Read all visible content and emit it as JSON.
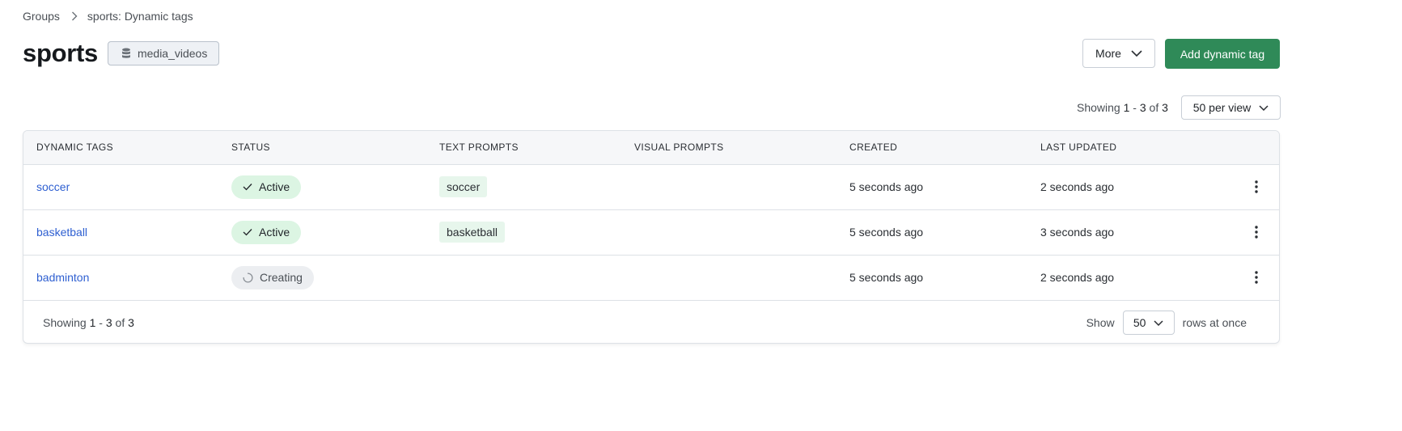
{
  "breadcrumb": {
    "parent": "Groups",
    "current": "sports: Dynamic tags"
  },
  "header": {
    "title": "sports",
    "index_badge": "media_videos",
    "more_label": "More",
    "add_label": "Add dynamic tag"
  },
  "pager_top": {
    "prefix": "Showing",
    "range_start": "1",
    "dash": "-",
    "range_end": "3",
    "of": "of",
    "total": "3",
    "per_view": "50 per view"
  },
  "table": {
    "columns": [
      "DYNAMIC TAGS",
      "STATUS",
      "TEXT PROMPTS",
      "VISUAL PROMPTS",
      "CREATED",
      "LAST UPDATED"
    ],
    "rows": [
      {
        "name": "soccer",
        "status": "Active",
        "status_kind": "active",
        "text_prompt": "soccer",
        "visual_prompt": "",
        "created": "5 seconds ago",
        "updated": "2 seconds ago"
      },
      {
        "name": "basketball",
        "status": "Active",
        "status_kind": "active",
        "text_prompt": "basketball",
        "visual_prompt": "",
        "created": "5 seconds ago",
        "updated": "3 seconds ago"
      },
      {
        "name": "badminton",
        "status": "Creating",
        "status_kind": "creating",
        "text_prompt": "",
        "visual_prompt": "",
        "created": "5 seconds ago",
        "updated": "2 seconds ago"
      }
    ]
  },
  "footer": {
    "prefix": "Showing",
    "range_start": "1",
    "dash": "-",
    "range_end": "3",
    "of": "of",
    "total": "3",
    "show_label": "Show",
    "rows_value": "50",
    "rows_suffix": "rows at once"
  },
  "colors": {
    "primary": "#2f8a58",
    "link": "#2e5fd1",
    "active_bg": "#dcf5e3",
    "chip_bg": "#e7f6ec"
  },
  "icons": {
    "breadcrumb_sep": "chevron-right-icon",
    "index": "database-icon",
    "dropdown": "chevron-down-icon",
    "active": "check-icon",
    "creating": "spinner-icon",
    "row_menu": "kebab-icon"
  }
}
